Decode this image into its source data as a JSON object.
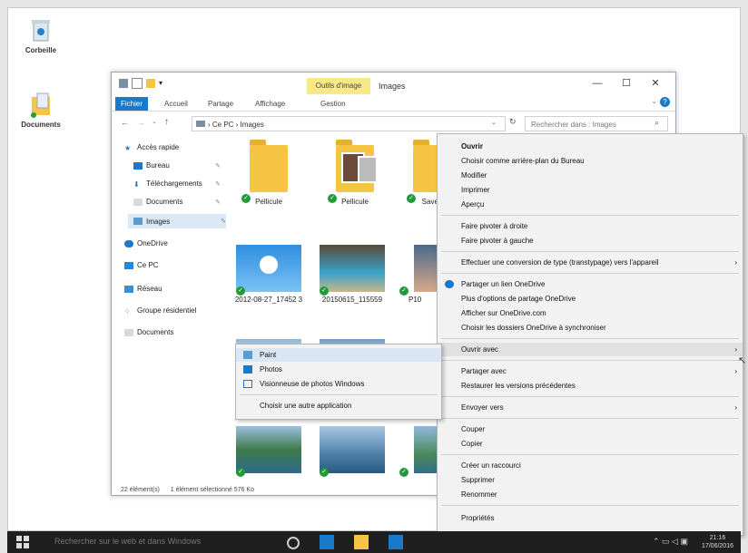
{
  "desktop": {
    "icons": [
      {
        "label": "Corbeille",
        "icon": "recycle-bin-icon"
      },
      {
        "label": "Documents",
        "icon": "documents-folder-icon"
      }
    ]
  },
  "window": {
    "tools_tab": "Outils d'image",
    "title": "Images",
    "ribbon_tabs": [
      "Fichier",
      "Accueil",
      "Partage",
      "Affichage",
      "Gestion"
    ],
    "address": "› Ce PC › Images",
    "search_placeholder": "Rechercher dans : Images",
    "nav": [
      {
        "label": "Accès rapide"
      },
      {
        "label": "Bureau"
      },
      {
        "label": "Téléchargements"
      },
      {
        "label": "Documents"
      },
      {
        "label": "Images"
      },
      {
        "label": "OneDrive"
      },
      {
        "label": "Ce PC"
      },
      {
        "label": "Réseau"
      },
      {
        "label": "Groupe résidentiel"
      },
      {
        "label": "Documents"
      }
    ],
    "tiles": [
      {
        "label": "Pellicule"
      },
      {
        "label": "Pellicule"
      },
      {
        "label": "Saved"
      },
      {
        "label": "2012-08-27_17452 3"
      },
      {
        "label": "20150615_115559"
      },
      {
        "label": "P10"
      }
    ],
    "status_count": "22 élément(s)",
    "status_selection": "1 élément sélectionné  576 Ko"
  },
  "context_menu": {
    "items": [
      "Ouvrir",
      "Choisir comme arrière-plan du Bureau",
      "Modifier",
      "Imprimer",
      "Aperçu",
      "Faire pivoter à droite",
      "Faire pivoter à gauche",
      "Effectuer une conversion de type (transtypage) vers l'appareil",
      "Partager un lien OneDrive",
      "Plus d'options de partage OneDrive",
      "Afficher sur OneDrive.com",
      "Choisir les dossiers OneDrive à synchroniser",
      "Ouvrir avec",
      "Partager avec",
      "Restaurer les versions précédentes",
      "Envoyer vers",
      "Couper",
      "Copier",
      "Créer un raccourci",
      "Supprimer",
      "Renommer",
      "Propriétés"
    ]
  },
  "submenu": {
    "items": [
      "Paint",
      "Photos",
      "Visionneuse de photos Windows",
      "Choisir une autre application"
    ]
  },
  "taskbar": {
    "search": "Rechercher sur le web et dans Windows",
    "time": "21:16",
    "date": "17/06/2016"
  },
  "colors": {
    "accent": "#1979ca",
    "check": "#1f9b3a",
    "folder": "#f5c543"
  }
}
